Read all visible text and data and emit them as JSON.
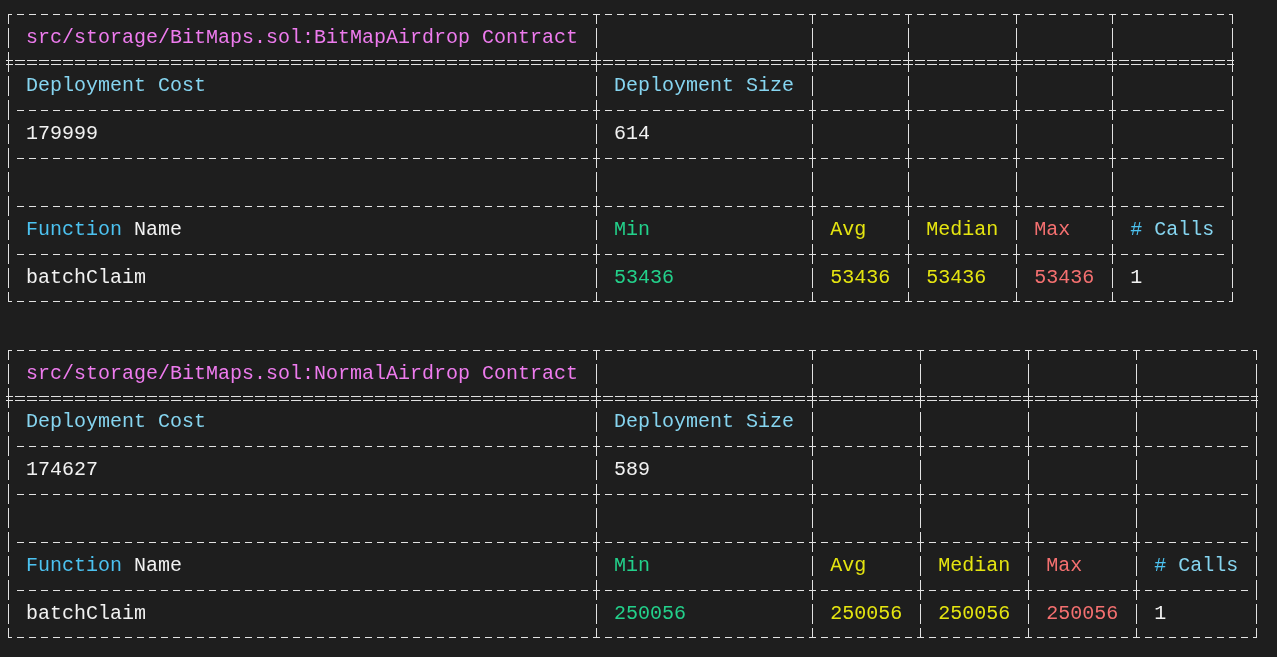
{
  "tables": [
    {
      "title": {
        "text": "src/storage/BitMaps.sol:BitMapAirdrop Contract",
        "color": "#ee7bee"
      },
      "deployment": {
        "columns": [
          {
            "text": "Deployment Cost",
            "color": "#86d5f0"
          },
          {
            "text": "Deployment Size",
            "color": "#86d5f0"
          }
        ],
        "rows": [
          [
            {
              "text": "179999",
              "color": "#f2f2f2"
            },
            {
              "text": "614",
              "color": "#f2f2f2"
            }
          ]
        ]
      },
      "functions": {
        "columns": [
          {
            "parts": [
              {
                "text": "Function",
                "color": "#4cc2f0"
              },
              {
                "text": "Name",
                "color": "#f2f2f2"
              }
            ]
          },
          {
            "parts": [
              {
                "text": "Min",
                "color": "#23d18b"
              }
            ]
          },
          {
            "parts": [
              {
                "text": "Avg",
                "color": "#e5e510"
              }
            ]
          },
          {
            "parts": [
              {
                "text": "Median",
                "color": "#e5e510"
              }
            ]
          },
          {
            "parts": [
              {
                "text": "Max",
                "color": "#f47070"
              }
            ]
          },
          {
            "parts": [
              {
                "text": "#",
                "color": "#4cc2f0"
              },
              {
                "text": "Calls",
                "color": "#86d5f0"
              }
            ]
          }
        ],
        "rows": [
          [
            {
              "text": "batchClaim",
              "color": "#f2f2f2"
            },
            {
              "text": "53436",
              "color": "#23d18b"
            },
            {
              "text": "53436",
              "color": "#e5e510"
            },
            {
              "text": "53436",
              "color": "#e5e510"
            },
            {
              "text": "53436",
              "color": "#f47070"
            },
            {
              "text": "1",
              "color": "#f2f2f2"
            }
          ]
        ]
      }
    },
    {
      "title": {
        "text": "src/storage/BitMaps.sol:NormalAirdrop Contract",
        "color": "#ee7bee"
      },
      "deployment": {
        "columns": [
          {
            "text": "Deployment Cost",
            "color": "#86d5f0"
          },
          {
            "text": "Deployment Size",
            "color": "#86d5f0"
          }
        ],
        "rows": [
          [
            {
              "text": "174627",
              "color": "#f2f2f2"
            },
            {
              "text": "589",
              "color": "#f2f2f2"
            }
          ]
        ]
      },
      "functions": {
        "columns": [
          {
            "parts": [
              {
                "text": "Function",
                "color": "#4cc2f0"
              },
              {
                "text": "Name",
                "color": "#f2f2f2"
              }
            ]
          },
          {
            "parts": [
              {
                "text": "Min",
                "color": "#23d18b"
              }
            ]
          },
          {
            "parts": [
              {
                "text": "Avg",
                "color": "#e5e510"
              }
            ]
          },
          {
            "parts": [
              {
                "text": "Median",
                "color": "#e5e510"
              }
            ]
          },
          {
            "parts": [
              {
                "text": "Max",
                "color": "#f47070"
              }
            ]
          },
          {
            "parts": [
              {
                "text": "#",
                "color": "#4cc2f0"
              },
              {
                "text": "Calls",
                "color": "#86d5f0"
              }
            ]
          }
        ],
        "rows": [
          [
            {
              "text": "batchClaim",
              "color": "#f2f2f2"
            },
            {
              "text": "250056",
              "color": "#23d18b"
            },
            {
              "text": "250056",
              "color": "#e5e510"
            },
            {
              "text": "250056",
              "color": "#e5e510"
            },
            {
              "text": "250056",
              "color": "#f47070"
            },
            {
              "text": "1",
              "color": "#f2f2f2"
            }
          ]
        ]
      }
    }
  ]
}
